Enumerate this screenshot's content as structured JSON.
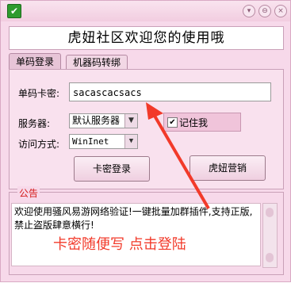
{
  "window": {
    "banner": "虎妞社区欢迎您的使用哦"
  },
  "tabs": [
    {
      "label": "单码登录"
    },
    {
      "label": "机器码转绑"
    }
  ],
  "form": {
    "card_label": "单码卡密:",
    "card_value": "sacascacsacs",
    "server_label": "服务器:",
    "server_value": "默认服务器",
    "remember_label": "记住我",
    "remember_checked": "✔",
    "access_label": "访问方式:",
    "access_value": "WinInet"
  },
  "buttons": {
    "login": "卡密登录",
    "market": "虎妞营销"
  },
  "notice": {
    "label": "公告",
    "text": "欢迎使用骚风易游网络验证!一键批量加群插件,支持正版,禁止盗版肆意横行!"
  },
  "overlay_text": "卡密随便写 点击登陆",
  "colors": {
    "accent": "#f23a2a",
    "window_bg": "#f7d9ea"
  }
}
